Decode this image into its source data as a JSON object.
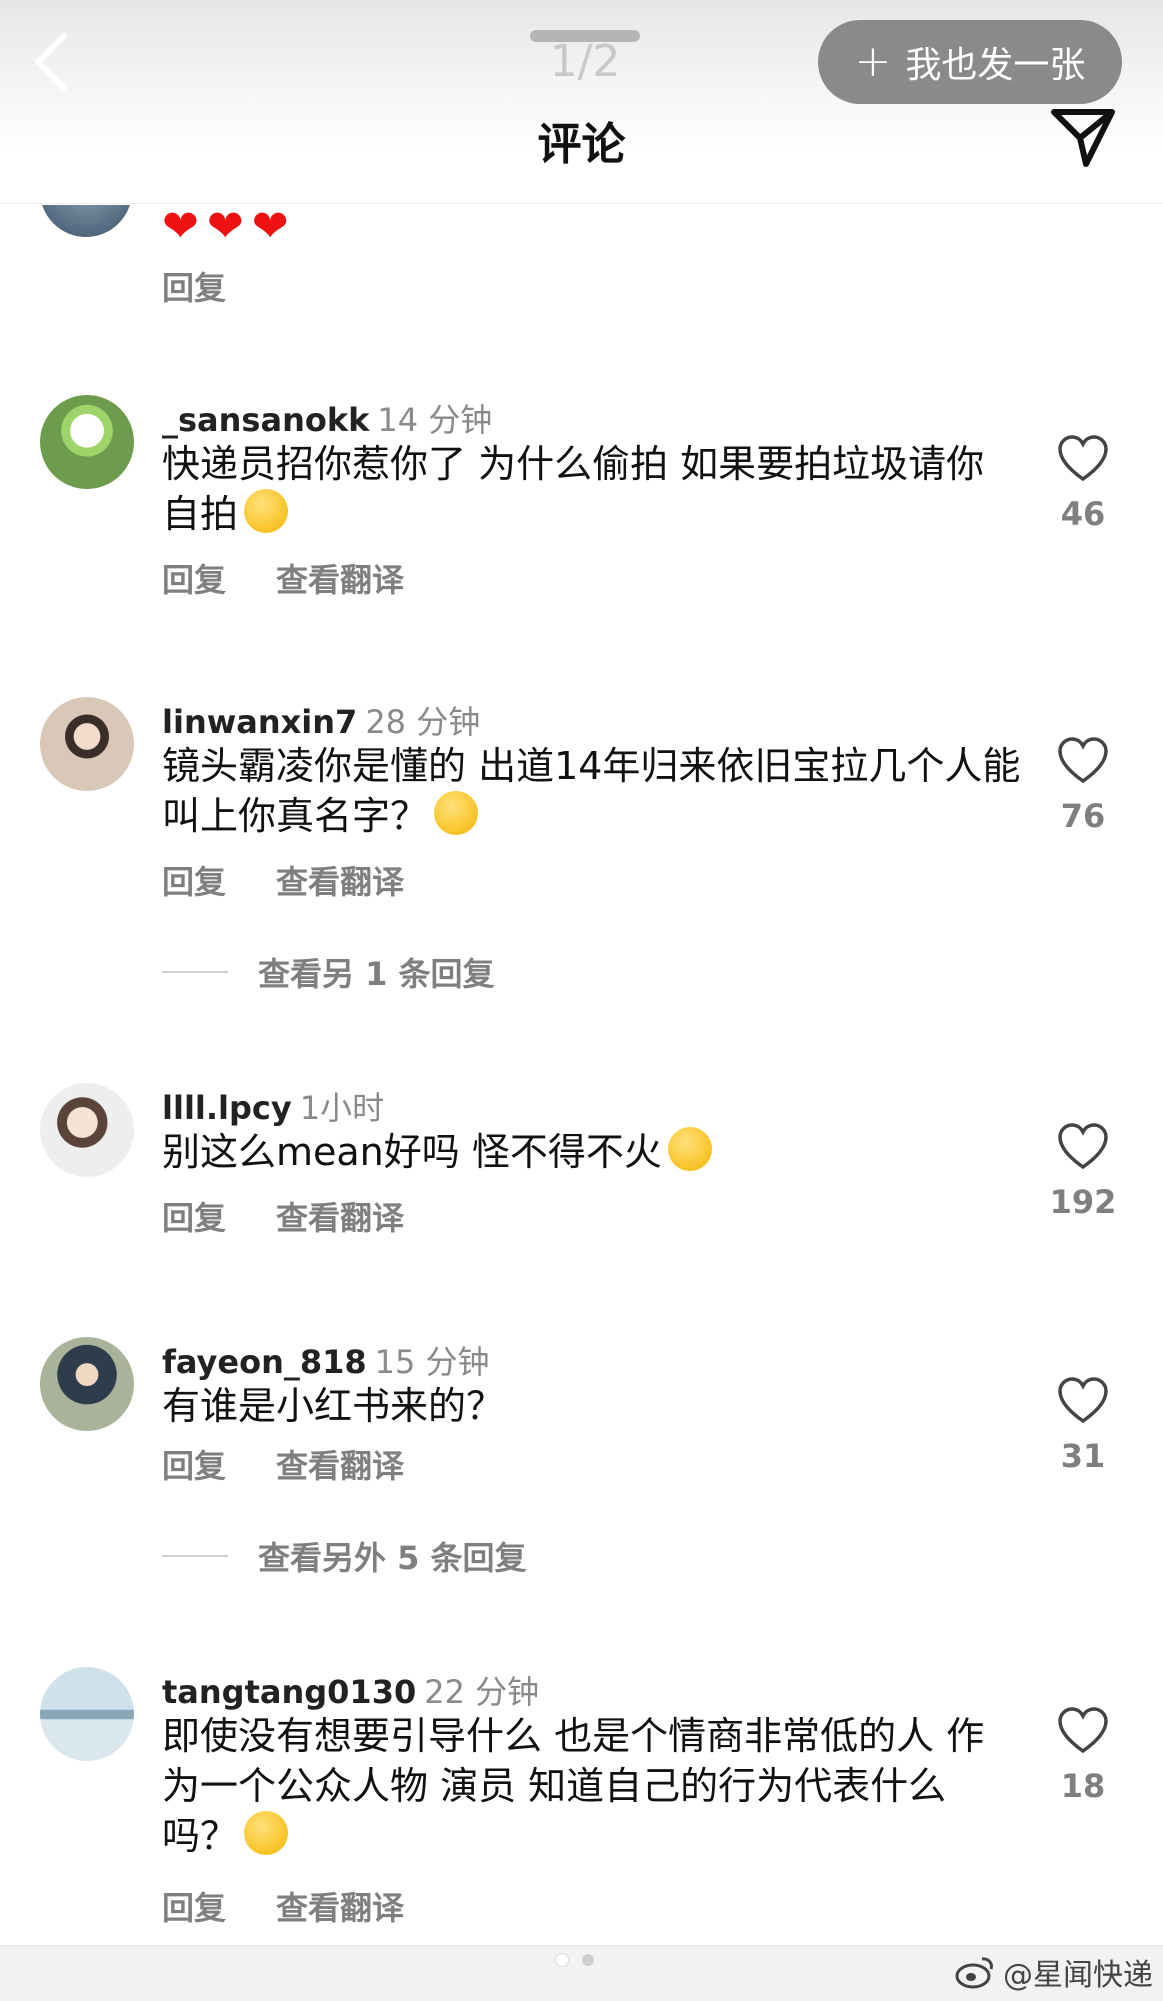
{
  "header": {
    "page_indicator": "1/2",
    "post_button_plus": "+",
    "post_button_label": "我也发一张",
    "title": "评论"
  },
  "partial_comment": {
    "hearts": "❤❤❤",
    "reply_label": "回复"
  },
  "comments": [
    {
      "username": "_sansanokk",
      "time": "14 分钟",
      "text": "快递员招你惹你了 为什么偷拍 如果要拍垃圾请你自拍",
      "emoji": "kissing-heart-emoji",
      "likes": "46",
      "reply_label": "回复",
      "translate_label": "查看翻译"
    },
    {
      "username": "linwanxin7",
      "time": "28 分钟",
      "text": "镜头霸凌你是懂的 出道14年归来依旧宝拉几个人能叫上你真名字？",
      "emoji": "rofl-emoji",
      "likes": "76",
      "reply_label": "回复",
      "translate_label": "查看翻译",
      "more_replies": "查看另 1 条回复"
    },
    {
      "username": "llll.lpcy",
      "time": "1小时",
      "text": "别这么mean好吗 怪不得不火",
      "emoji": "crying-emoji",
      "likes": "192",
      "reply_label": "回复",
      "translate_label": "查看翻译"
    },
    {
      "username": "fayeon_818",
      "time": "15 分钟",
      "text": "有谁是小红书来的？",
      "likes": "31",
      "reply_label": "回复",
      "translate_label": "查看翻译",
      "more_replies": "查看另外 5 条回复"
    },
    {
      "username": "tangtang0130",
      "time": "22 分钟",
      "text": "即使没有想要引导什么 也是个情商非常低的人 作为一个公众人物 演员 知道自己的行为代表什么吗？",
      "emoji": "sweat-smile-emoji",
      "likes": "18",
      "reply_label": "回复",
      "translate_label": "查看翻译"
    }
  ],
  "footer": {
    "watermark": "@星闻快递"
  },
  "colors": {
    "post_button_bg": "#8a8a8a",
    "secondary_text": "#7f7f7f",
    "heart_red": "#e11111"
  }
}
